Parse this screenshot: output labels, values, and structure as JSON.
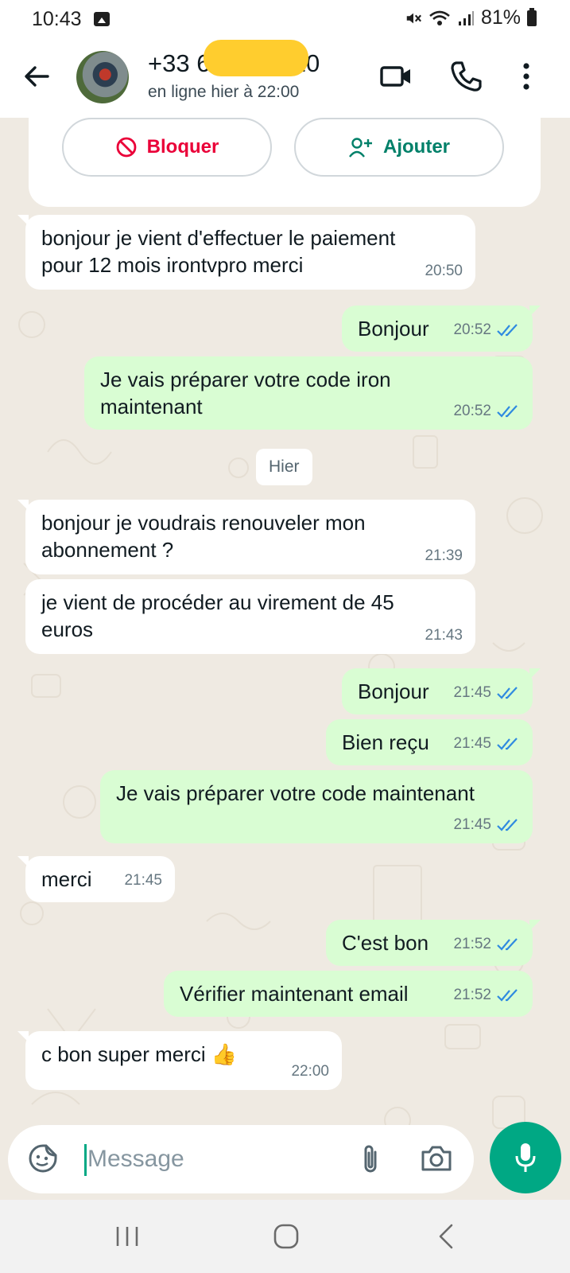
{
  "status_bar": {
    "time": "10:43",
    "battery": "81%"
  },
  "header": {
    "contact_name": "+33 6 ·· ·· ·5 10",
    "contact_status": "en ligne hier à 22:00"
  },
  "actions": {
    "block_label": "Bloquer",
    "add_label": "Ajouter"
  },
  "date_chip": "Hier",
  "messages": [
    {
      "dir": "in",
      "text": "bonjour je vient d'effectuer le paiement\npour 12 mois irontvpro merci",
      "time": "20:50"
    },
    {
      "dir": "out",
      "text": "Bonjour",
      "time": "20:52",
      "read": true
    },
    {
      "dir": "out",
      "text": "Je vais préparer votre code iron\nmaintenant",
      "time": "20:52",
      "read": true
    },
    {
      "dir": "in",
      "text": "bonjour je voudrais renouveler mon\nabonnement ?",
      "time": "21:39"
    },
    {
      "dir": "in",
      "text": "je vient de procéder au virement de 45\neuros",
      "time": "21:43"
    },
    {
      "dir": "out",
      "text": "Bonjour",
      "time": "21:45",
      "read": true
    },
    {
      "dir": "out",
      "text": "Bien reçu",
      "time": "21:45",
      "read": true
    },
    {
      "dir": "out",
      "text": "Je vais préparer votre code maintenant",
      "time": "21:45",
      "read": true
    },
    {
      "dir": "in",
      "text": "merci",
      "time": "21:45"
    },
    {
      "dir": "out",
      "text": "C'est bon",
      "time": "21:52",
      "read": true
    },
    {
      "dir": "out",
      "text": "Vérifier maintenant email",
      "time": "21:52",
      "read": true
    },
    {
      "dir": "in",
      "text": "c bon super merci 👍",
      "time": "22:00"
    }
  ],
  "composer": {
    "placeholder": "Message"
  },
  "icons": {
    "back": "arrow-left-icon",
    "video": "video-call-icon",
    "call": "phone-icon",
    "menu": "more-vertical-icon",
    "sticker": "sticker-icon",
    "attach": "paperclip-icon",
    "camera": "camera-icon",
    "mic": "microphone-icon",
    "read_receipt": "double-check-icon"
  },
  "colors": {
    "accent": "#00a884",
    "outgoing_bubble": "#d9fdd3",
    "incoming_bubble": "#ffffff",
    "chat_background": "#efeae2",
    "block_red": "#ea0038",
    "read_tick_blue": "#53bdeb"
  }
}
